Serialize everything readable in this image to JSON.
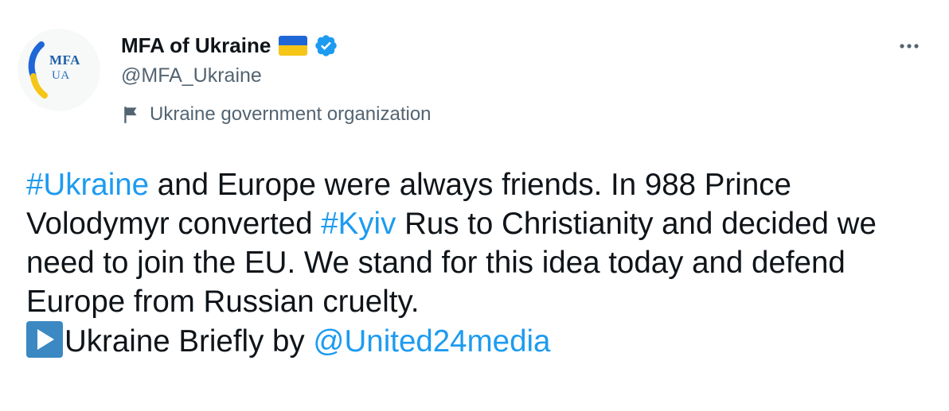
{
  "author": {
    "display_name": "MFA of Ukraine",
    "handle": "@MFA_Ukraine",
    "account_label": "Ukraine government organization",
    "avatar": {
      "logo_line1": "MFA",
      "logo_line2": "UA"
    }
  },
  "tweet": {
    "hashtag_ukraine": "#Ukraine",
    "text_1": " and Europe were always friends. In 988 Prince Volodymyr converted ",
    "hashtag_kyiv": "#Kyiv",
    "text_2": " Rus to Christianity and decided we need to join the EU. We stand for this idea today and defend Europe from Russian cruelty.",
    "text_3": "Ukraine Briefly by ",
    "mention": "@United24media"
  },
  "icons": {
    "verified": "verified-badge-icon",
    "flag": "ukraine-flag-icon",
    "label": "flag-outline-icon",
    "more": "more-dots-icon",
    "play": "play-button-emoji"
  },
  "colors": {
    "link": "#1d9bf0",
    "text": "#0f1419",
    "secondary": "#536471",
    "flag_blue": "#1f67d6",
    "flag_yellow": "#f5c518"
  }
}
